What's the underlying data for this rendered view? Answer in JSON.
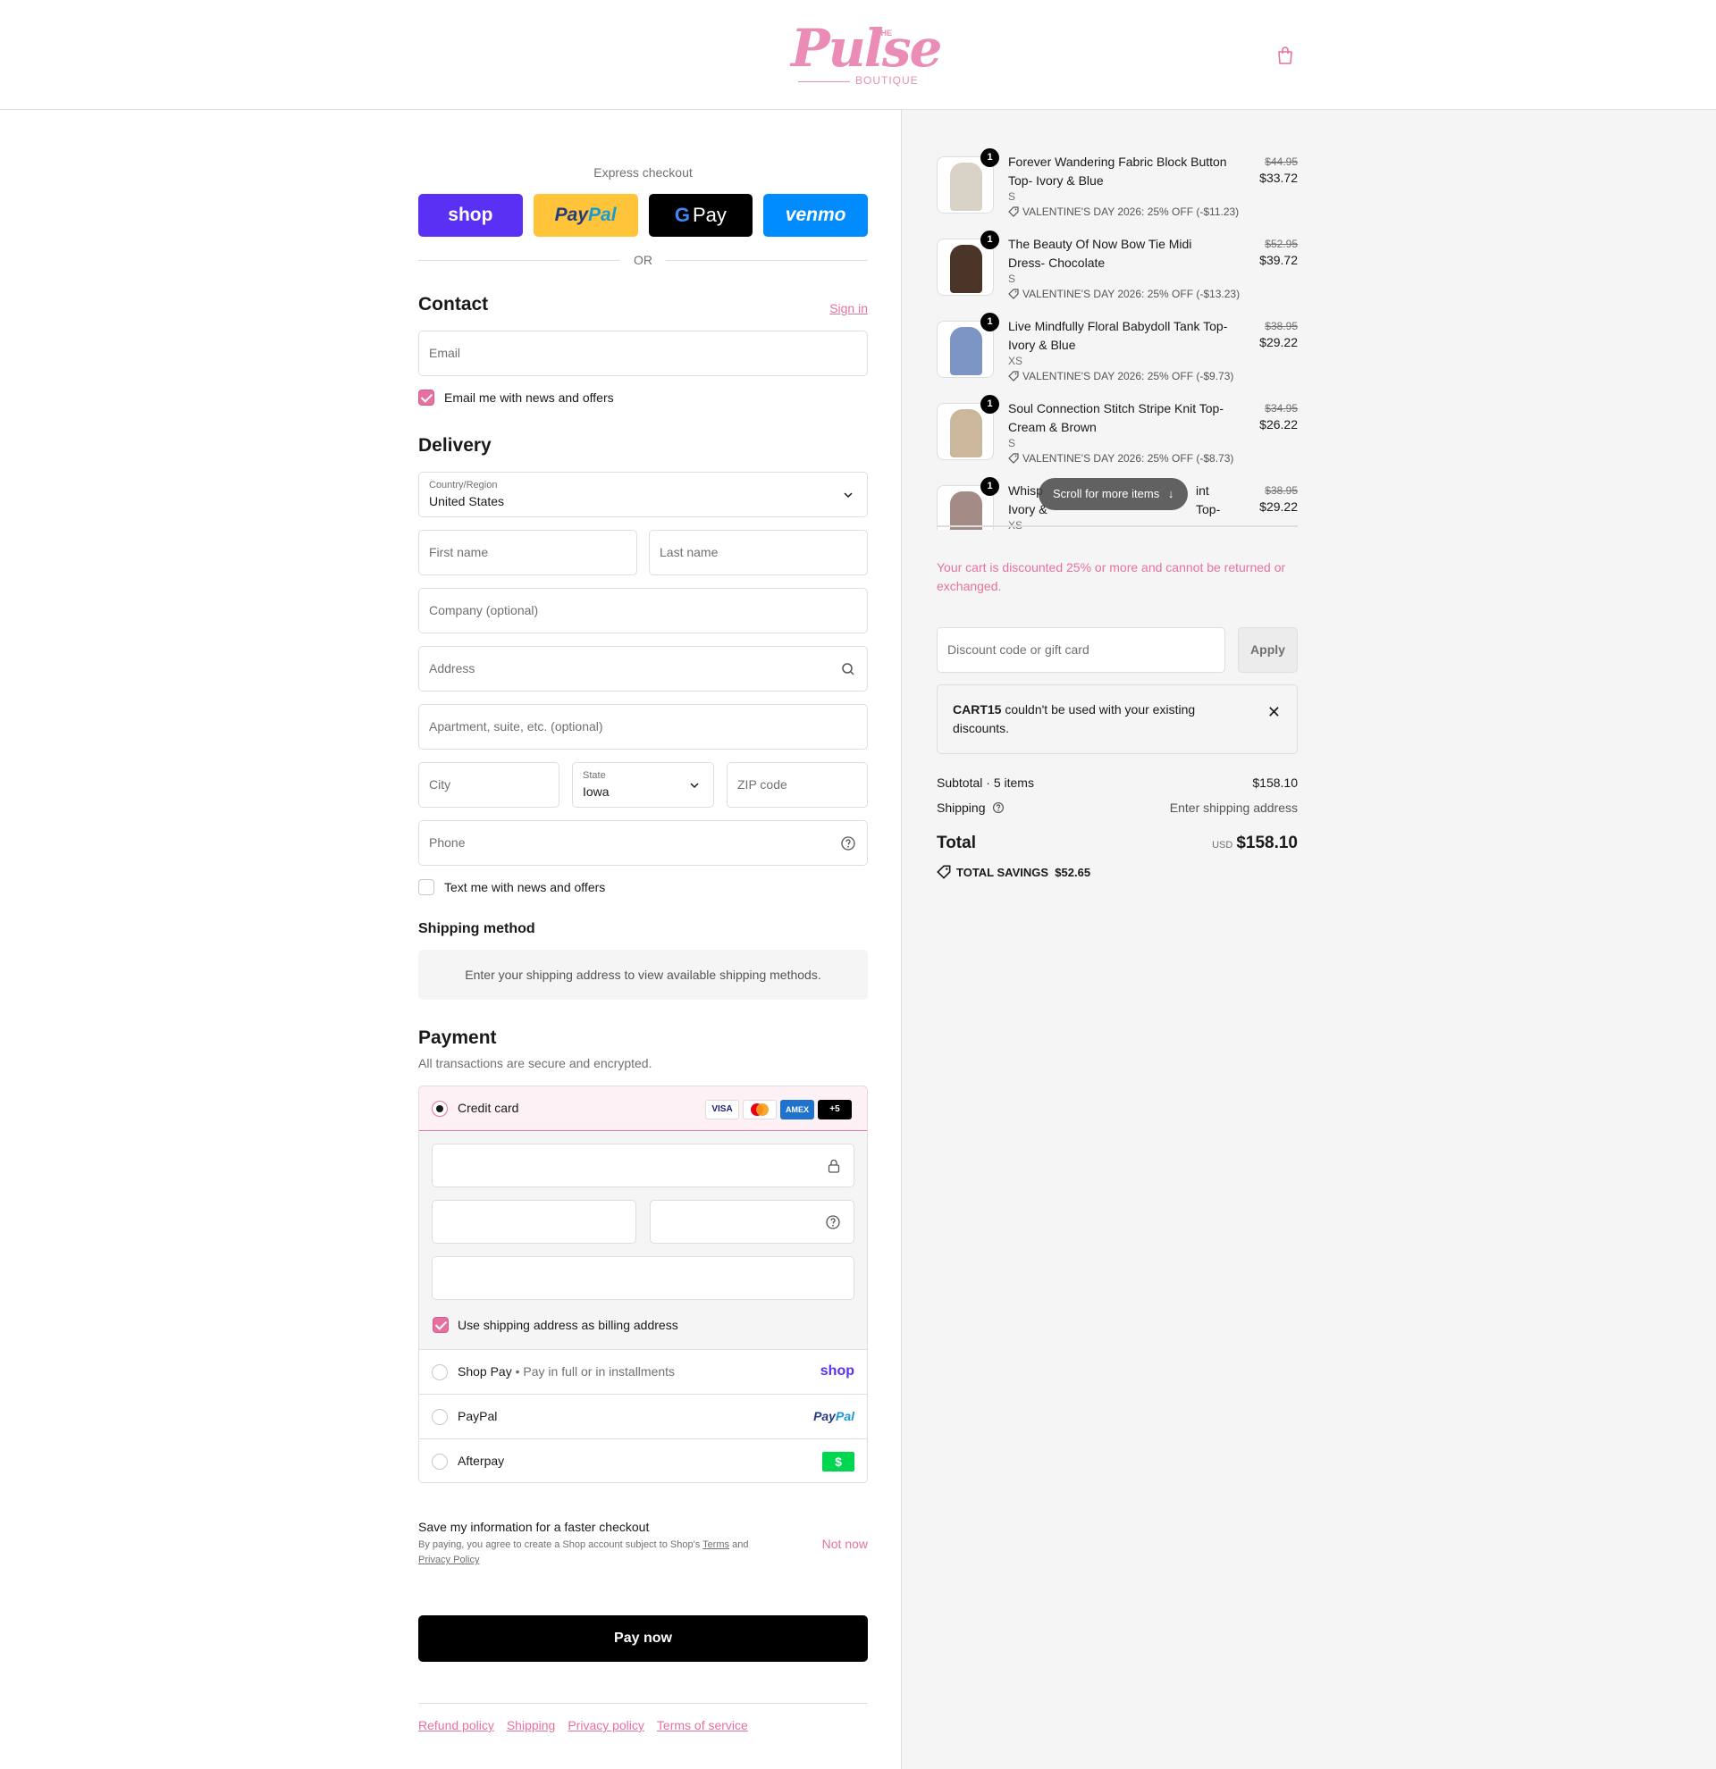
{
  "header": {
    "logo_small": "THE",
    "logo_main": "Pulse",
    "logo_sub": "BOUTIQUE",
    "cart_icon": "shopping-bag-icon"
  },
  "express": {
    "title": "Express checkout",
    "shop_label": "shop",
    "paypal_label_a": "Pay",
    "paypal_label_b": "Pal",
    "gpay_label": "Pay",
    "venmo_label": "venmo",
    "or_label": "OR"
  },
  "contact": {
    "heading": "Contact",
    "sign_in": "Sign in",
    "email_placeholder": "Email",
    "news_label": "Email me with news and offers"
  },
  "delivery": {
    "heading": "Delivery",
    "country_label": "Country/Region",
    "country_value": "United States",
    "first_name": "First name",
    "last_name": "Last name",
    "company": "Company (optional)",
    "address": "Address",
    "apartment": "Apartment, suite, etc. (optional)",
    "city": "City",
    "state_label": "State",
    "state_value": "Iowa",
    "zip": "ZIP code",
    "phone": "Phone",
    "text_label": "Text me with news and offers"
  },
  "shipping_method": {
    "heading": "Shipping method",
    "notice": "Enter your shipping address to view available shipping methods."
  },
  "payment": {
    "heading": "Payment",
    "subtitle": "All transactions are secure and encrypted.",
    "credit_card": "Credit card",
    "brands": [
      "VISA",
      "",
      "AMEX",
      "+5"
    ],
    "billing_label": "Use shipping address as billing address",
    "shop_pay": "Shop Pay",
    "shop_pay_sub": "Pay in full or in installments",
    "shop_pay_logo": "shop",
    "paypal": "PayPal",
    "paypal_logo_a": "Pay",
    "paypal_logo_b": "Pal",
    "afterpay": "Afterpay",
    "afterpay_logo": "$"
  },
  "save_info": {
    "title": "Save my information for a faster checkout",
    "legal_prefix": "By paying, you agree to create a Shop account subject to Shop's",
    "terms": "Terms",
    "and": "and",
    "privacy": "Privacy Policy",
    "not_now": "Not now"
  },
  "pay_now": "Pay now",
  "footer": [
    "Refund policy",
    "Shipping",
    "Privacy policy",
    "Terms of service"
  ],
  "cart": {
    "items": [
      {
        "name": "Forever Wandering Fabric Block Button Top- Ivory & Blue",
        "variant": "S",
        "discount": "VALENTINE'S DAY 2026: 25% OFF (-$11.23)",
        "old_price": "$44.95",
        "price": "$33.72",
        "qty": "1",
        "color": "#d9d2c6"
      },
      {
        "name": "The Beauty Of Now Bow Tie Midi Dress- Chocolate",
        "variant": "S",
        "discount": "VALENTINE'S DAY 2026: 25% OFF (-$13.23)",
        "old_price": "$52.95",
        "price": "$39.72",
        "qty": "1",
        "color": "#4a3528"
      },
      {
        "name": "Live Mindfully Floral Babydoll Tank Top- Ivory & Blue",
        "variant": "XS",
        "discount": "VALENTINE'S DAY 2026: 25% OFF (-$9.73)",
        "old_price": "$38.95",
        "price": "$29.22",
        "qty": "1",
        "color": "#7d95c4"
      },
      {
        "name": "Soul Connection Stitch Stripe Knit Top- Cream & Brown",
        "variant": "S",
        "discount": "VALENTINE'S DAY 2026: 25% OFF (-$8.73)",
        "old_price": "$34.95",
        "price": "$26.22",
        "qty": "1",
        "color": "#cbb79b"
      },
      {
        "name": "Whisp",
        "name_tail": "int Top-",
        "name_line2": "Ivory &",
        "variant": "XS",
        "old_price": "$38.95",
        "price": "$29.22",
        "qty": "1",
        "color": "#a48b86"
      }
    ],
    "scroll_hint": "Scroll for more items",
    "warning": "Your cart is discounted 25% or more and cannot be returned or exchanged.",
    "discount_placeholder": "Discount code or gift card",
    "apply": "Apply",
    "error_code": "CART15",
    "error_text": " couldn't be used with your existing discounts.",
    "subtotal_label": "Subtotal · 5 items",
    "subtotal": "$158.10",
    "shipping_label": "Shipping",
    "shipping_value": "Enter shipping address",
    "total_label": "Total",
    "currency": "USD",
    "total": "$158.10",
    "savings_label": "TOTAL SAVINGS",
    "savings": "$52.65"
  },
  "colors": {
    "accent": "#e571a0",
    "shop": "#5a31f4",
    "paypal": "#ffc439",
    "venmo": "#008cff"
  }
}
